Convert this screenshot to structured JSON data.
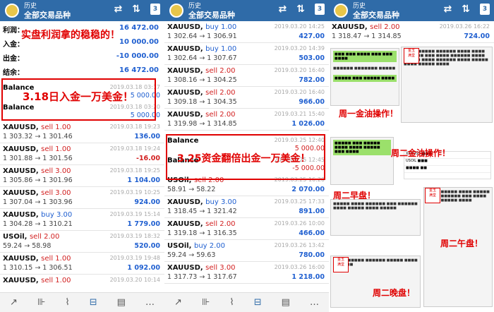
{
  "header": {
    "title": "历史",
    "subtitle": "全部交易品种",
    "cal": "3"
  },
  "panel1": {
    "summary": [
      {
        "label": "利润：",
        "value": "16 472.00"
      },
      {
        "label": "入金：",
        "value": "10 000.00"
      },
      {
        "label": "出金：",
        "value": "-10 000.00"
      },
      {
        "label": "结余：",
        "value": "16 472.00"
      }
    ],
    "balances": [
      {
        "sym": "Balance",
        "date": "2019.03.18 03:17",
        "profit": "5 000.00"
      },
      {
        "sym": "Balance",
        "date": "2019.03.18 03:20",
        "profit": "5 000.00"
      }
    ],
    "rows": [
      {
        "sym": "XAUUSD,",
        "side": "sell",
        "lot": "1.00",
        "px": "1 303.32 → 1 301.46",
        "date": "2019.03.18 19:23",
        "profit": "136.00",
        "neg": false
      },
      {
        "sym": "XAUUSD,",
        "side": "sell",
        "lot": "1.00",
        "px": "1 301.88 → 1 301.56",
        "date": "2019.03.18 19:24",
        "profit": "-16.00",
        "neg": true
      },
      {
        "sym": "XAUUSD,",
        "side": "sell",
        "lot": "3.00",
        "px": "1 305.86 → 1 301.96",
        "date": "2019.03.18 19:25",
        "profit": "1 104.00",
        "neg": false
      },
      {
        "sym": "XAUUSD,",
        "side": "sell",
        "lot": "3.00",
        "px": "1 307.04 → 1 303.96",
        "date": "2019.03.19 10:25",
        "profit": "924.00",
        "neg": false
      },
      {
        "sym": "XAUUSD,",
        "side": "buy",
        "lot": "3.00",
        "px": "1 304.28 → 1 310.21",
        "date": "2019.03.19 15:14",
        "profit": "1 779.00",
        "neg": false
      },
      {
        "sym": "USOil,",
        "side": "sell",
        "lot": "2.00",
        "px": "59.24 → 58.98",
        "date": "2019.03.19 18:32",
        "profit": "520.00",
        "neg": false
      },
      {
        "sym": "XAUUSD,",
        "side": "sell",
        "lot": "1.00",
        "px": "1 310.15 → 1 306.51",
        "date": "2019.03.19 19:48",
        "profit": "1 092.00",
        "neg": false
      },
      {
        "sym": "XAUUSD,",
        "side": "sell",
        "lot": "1.00",
        "px": "",
        "date": "2019.03.20 10:14",
        "profit": "",
        "neg": false
      }
    ],
    "caption1": "实盘利润拿的稳稳的！",
    "caption2": "3.18日入金一万美金！"
  },
  "panel2": {
    "rows": [
      {
        "sym": "XAUUSD,",
        "side": "buy",
        "lot": "1.00",
        "px": "1 302.64 → 1 306.91",
        "date": "2019.03.20 14:25",
        "profit": "427.00",
        "neg": false
      },
      {
        "sym": "XAUUSD,",
        "side": "buy",
        "lot": "1.00",
        "px": "1 302.64 → 1 307.67",
        "date": "2019.03.20 14:39",
        "profit": "503.00",
        "neg": false
      },
      {
        "sym": "XAUUSD,",
        "side": "sell",
        "lot": "2.00",
        "px": "1 308.16 → 1 304.25",
        "date": "2019.03.20 16:40",
        "profit": "782.00",
        "neg": false
      },
      {
        "sym": "XAUUSD,",
        "side": "sell",
        "lot": "2.00",
        "px": "1 309.18 → 1 304.35",
        "date": "2019.03.20 16:40",
        "profit": "966.00",
        "neg": false
      },
      {
        "sym": "XAUUSD,",
        "side": "sell",
        "lot": "2.00",
        "px": "1 319.98 → 1 314.85",
        "date": "2019.03.21 15:40",
        "profit": "1 026.00",
        "neg": false
      }
    ],
    "balances": [
      {
        "sym": "Balance",
        "date": "2019.03.25 12:40",
        "profit": "5 000.00",
        "neg": true
      },
      {
        "sym": "Balance",
        "date": "2019.03.25 12:45",
        "profit": "-5 000.00",
        "neg": true
      }
    ],
    "rows2": [
      {
        "sym": "USOil,",
        "side": "sell",
        "lot": "2.00",
        "px": "58.91 → 58.22",
        "date": "2019.03.25 16:20",
        "profit": "2 070.00",
        "neg": false
      },
      {
        "sym": "XAUUSD,",
        "side": "buy",
        "lot": "3.00",
        "px": "1 318.45 → 1 321.42",
        "date": "2019.03.25 17:33",
        "profit": "891.00",
        "neg": false
      },
      {
        "sym": "XAUUSD,",
        "side": "sell",
        "lot": "2.00",
        "px": "1 319.18 → 1 316.35",
        "date": "2019.03.26 10:00",
        "profit": "466.00",
        "neg": false
      },
      {
        "sym": "USOil,",
        "side": "buy",
        "lot": "2.00",
        "px": "59.24 → 59.63",
        "date": "2019.03.26 13:42",
        "profit": "780.00",
        "neg": false
      },
      {
        "sym": "XAUUSD,",
        "side": "sell",
        "lot": "3.00",
        "px": "1 317.73 → 1 317.67",
        "date": "2019.03.26 16:00",
        "profit": "1 218.00",
        "neg": false
      }
    ],
    "caption": "3.25资金翻倍出金一万美金！"
  },
  "panel3": {
    "top": {
      "sym": "XAUUSD,",
      "side": "sell",
      "lot": "2.00",
      "px": "1 318.47 → 1 314.85",
      "date": "2019.03.26 16:22",
      "profit": "724.00"
    },
    "captions": [
      "周一金油操作！",
      "周二金油操作！",
      "周二早盘！",
      "周二午盘！",
      "周二晚盘！"
    ],
    "stamp": "金玉满堂"
  },
  "nav": [
    "↗",
    "⊪",
    "⌇",
    "⊟",
    "▤",
    "…"
  ]
}
